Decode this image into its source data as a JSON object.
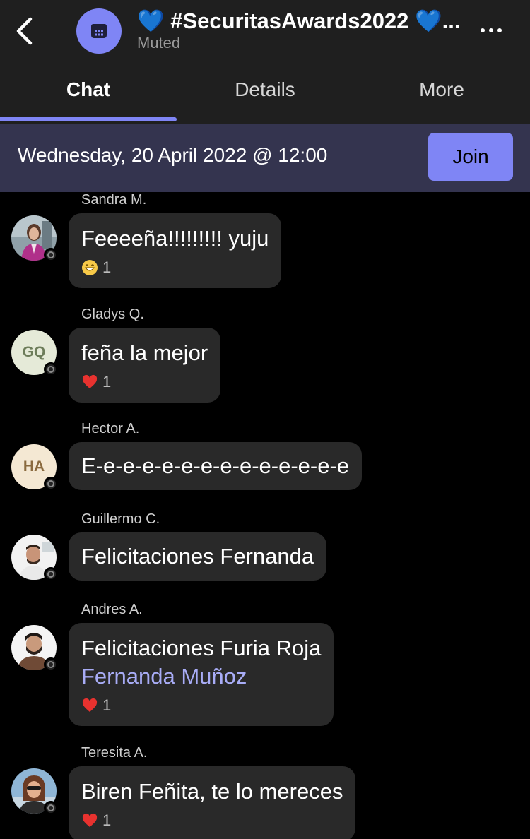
{
  "header": {
    "title": "💙 #SecuritasAwards2022 💙...",
    "subtitle": "Muted",
    "back_icon": "chevron-left-icon",
    "more_icon": "ellipsis-icon",
    "channel_icon": "calendar-icon"
  },
  "tabs": [
    {
      "label": "Chat",
      "active": true
    },
    {
      "label": "Details",
      "active": false
    },
    {
      "label": "More",
      "active": false
    }
  ],
  "meeting": {
    "datetime": "Wednesday, 20 April 2022 @ 12:00",
    "join_label": "Join"
  },
  "messages": [
    {
      "sender": "Sandra M.",
      "text": "Feeeeña!!!!!!!!! yuju",
      "reaction": {
        "icon": "grin-emoji-icon",
        "count": "1"
      }
    },
    {
      "sender": "Gladys Q.",
      "initials": "GQ",
      "text": "feña la mejor",
      "reaction": {
        "icon": "heart-icon",
        "count": "1"
      }
    },
    {
      "sender": "Hector A.",
      "initials": "HA",
      "text": "E-e-e-e-e-e-e-e-e-e-e-e-e-e"
    },
    {
      "sender": "Guillermo C.",
      "text": "Felicitaciones Fernanda"
    },
    {
      "sender": "Andres A.",
      "text": "Felicitaciones Furia Roja",
      "mention": "Fernanda Muñoz",
      "reaction": {
        "icon": "heart-icon",
        "count": "1"
      }
    },
    {
      "sender": "Teresita A.",
      "text": "Biren Feñita, te lo mereces",
      "reaction": {
        "icon": "heart-icon",
        "count": "1"
      }
    }
  ],
  "colors": {
    "accent": "#7f85f5",
    "header_bg": "#1f1f1f",
    "meeting_bar_bg": "#34344f",
    "bubble_bg": "#292929",
    "mention": "#a8acf6",
    "heart": "#e8322f"
  }
}
